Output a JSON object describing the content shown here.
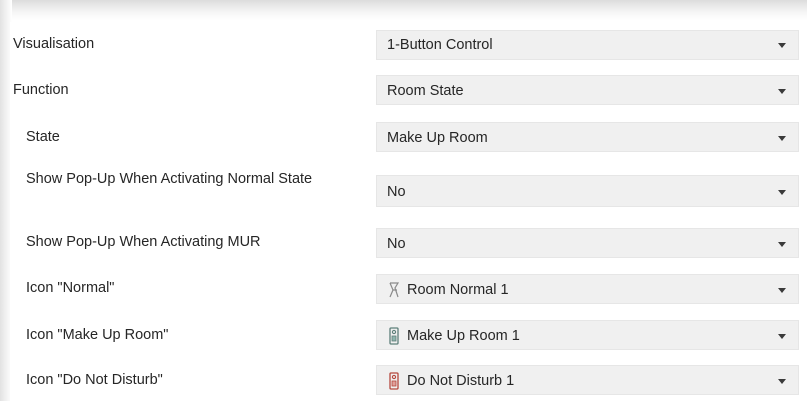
{
  "rows": [
    {
      "label": "Visualisation",
      "value": "1-Button Control",
      "icon": null
    },
    {
      "label": "Function",
      "value": "Room State",
      "icon": null
    },
    {
      "label": "State",
      "value": "Make Up Room",
      "icon": null
    },
    {
      "label": "Show Pop-Up When Activating Normal State",
      "value": "No",
      "icon": null
    },
    {
      "label": "Show Pop-Up When Activating MUR",
      "value": "No",
      "icon": null
    },
    {
      "label": "Icon \"Normal\"",
      "value": "Room Normal 1",
      "icon": "room-normal-icon"
    },
    {
      "label": "Icon \"Make Up Room\"",
      "value": "Make Up Room 1",
      "icon": "make-up-room-icon"
    },
    {
      "label": "Icon \"Do Not Disturb\"",
      "value": "Do Not Disturb 1",
      "icon": "do-not-disturb-icon"
    }
  ],
  "colors": {
    "select_bg": "#f0f0f0",
    "text": "#262626",
    "icon_normal": "#8a8a8a",
    "icon_mur": "#6e8f8a",
    "icon_dnd": "#b5483e"
  }
}
